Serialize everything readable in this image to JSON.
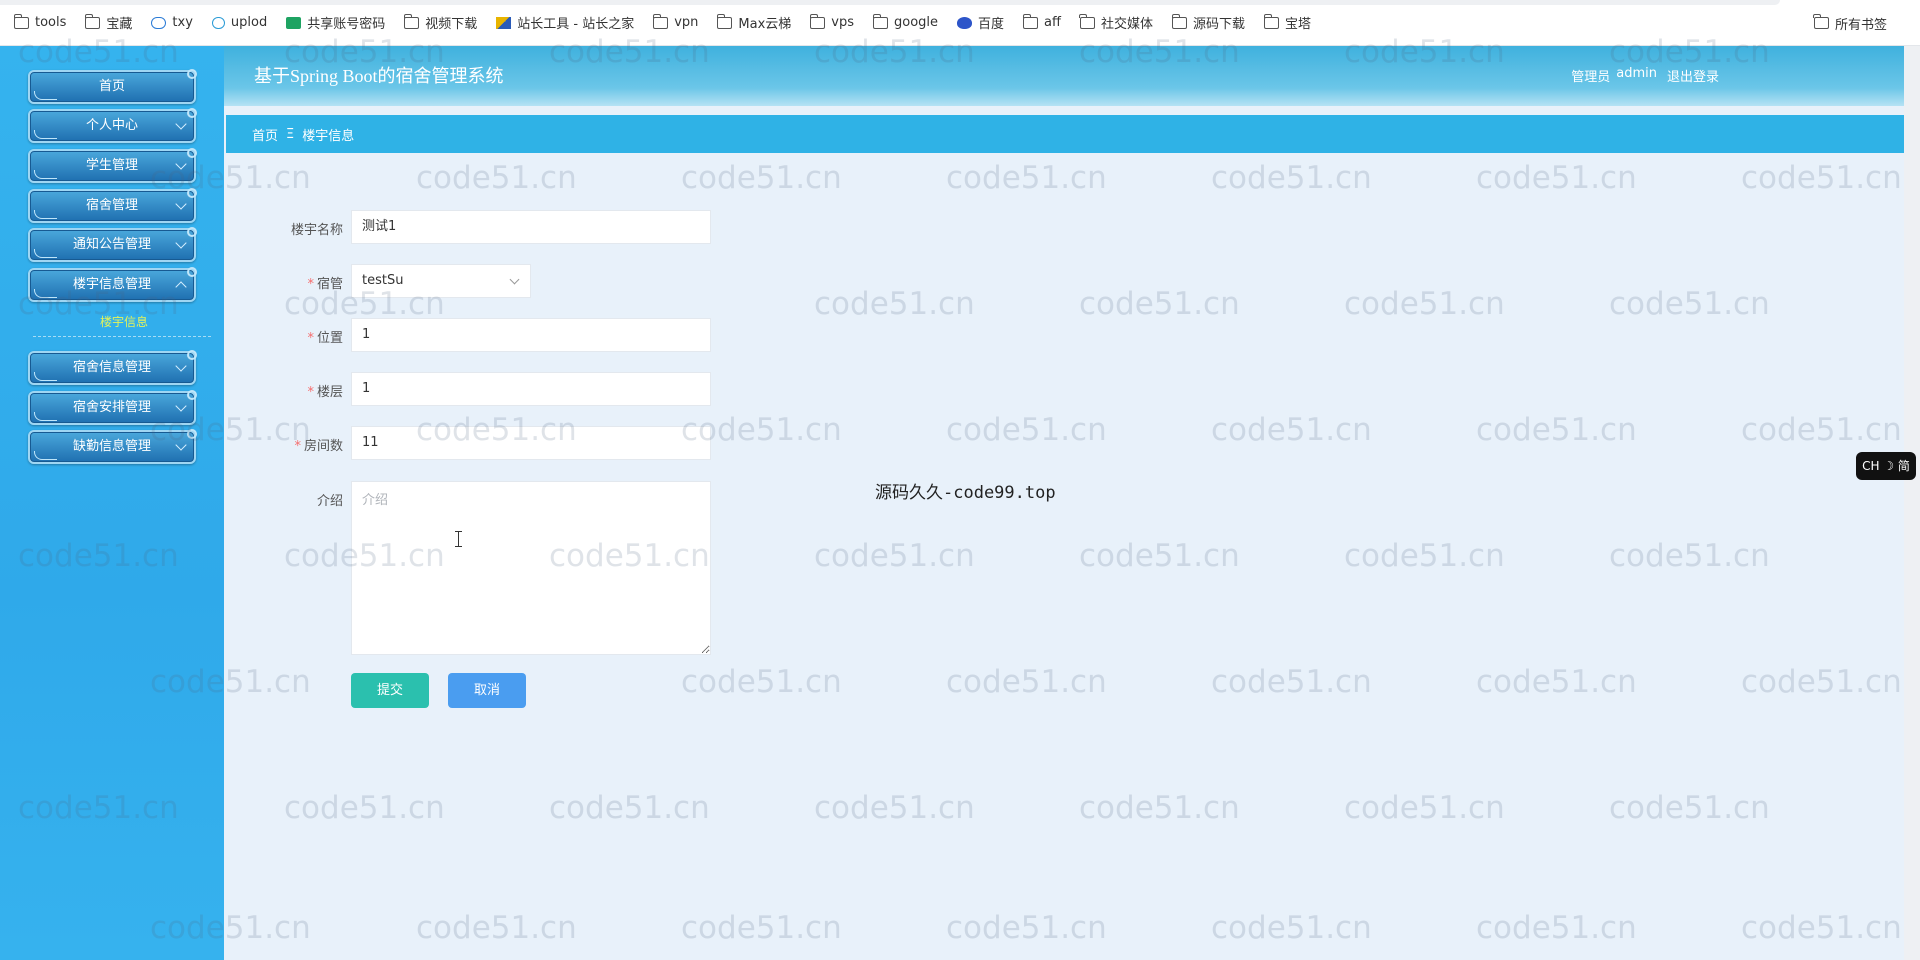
{
  "bookmarks": {
    "items": [
      {
        "label": "tools",
        "icon": "folder-icon"
      },
      {
        "label": "宝藏",
        "icon": "folder-icon"
      },
      {
        "label": "txy",
        "icon": "cloud-icon"
      },
      {
        "label": "uplod",
        "icon": "link-icon"
      },
      {
        "label": "共享账号密码",
        "icon": "spreadsheet-icon"
      },
      {
        "label": "视频下载",
        "icon": "folder-icon"
      },
      {
        "label": "站长工具 - 站长之家",
        "icon": "webmaster-tool-icon"
      },
      {
        "label": "vpn",
        "icon": "folder-icon"
      },
      {
        "label": "Max云梯",
        "icon": "folder-icon"
      },
      {
        "label": "vps",
        "icon": "folder-icon"
      },
      {
        "label": "google",
        "icon": "folder-icon"
      },
      {
        "label": "百度",
        "icon": "baidu-paw-icon"
      },
      {
        "label": "aff",
        "icon": "folder-icon"
      },
      {
        "label": "社交媒体",
        "icon": "folder-icon"
      },
      {
        "label": "源码下载",
        "icon": "folder-icon"
      },
      {
        "label": "宝塔",
        "icon": "folder-icon"
      }
    ],
    "all_bookmarks": "所有书签"
  },
  "sidebar": {
    "menu": [
      {
        "label": "首页"
      },
      {
        "label": "个人中心"
      },
      {
        "label": "学生管理"
      },
      {
        "label": "宿舍管理"
      },
      {
        "label": "通知公告管理"
      },
      {
        "label": "楼宇信息管理"
      },
      {
        "label": "宿舍信息管理"
      },
      {
        "label": "宿舍安排管理"
      },
      {
        "label": "缺勤信息管理"
      }
    ],
    "active_submenu": "楼宇信息"
  },
  "header": {
    "title": "基于Spring Boot的宿舍管理系统",
    "role": "管理员",
    "username": "admin",
    "logout": "退出登录"
  },
  "breadcrumb": {
    "home": "首页",
    "separator": "Ξ",
    "current": "楼宇信息"
  },
  "form": {
    "name_label": "楼宇名称",
    "name_value": "测试1",
    "manager_label": "宿管",
    "manager_value": "testSu",
    "location_label": "位置",
    "location_value": "1",
    "floor_label": "楼层",
    "floor_value": "1",
    "rooms_label": "房间数",
    "rooms_value": "11",
    "intro_label": "介绍",
    "intro_placeholder": "介绍",
    "required_mark": "*",
    "submit": "提交",
    "cancel": "取消"
  },
  "overlay_text": "源码久久-code99.top",
  "watermark": "code51.cn",
  "ime_indicator": "CH ☽ 简"
}
